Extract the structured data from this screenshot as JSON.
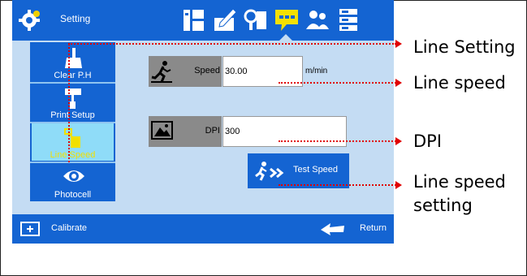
{
  "header": {
    "title": "Setting"
  },
  "sidebar": {
    "items": [
      {
        "label": "Clear P.H"
      },
      {
        "label": "Print Setup"
      },
      {
        "label": "Line Speed"
      },
      {
        "label": "Photocell"
      }
    ]
  },
  "speed": {
    "label": "Speed",
    "value": "30.00",
    "unit": "m/min"
  },
  "dpi": {
    "label": "DPI",
    "value": "300"
  },
  "test_button": {
    "label": "Test Speed"
  },
  "footer": {
    "calibrate_label": "Calibrate",
    "return_label": "Return"
  },
  "callouts": {
    "line_setting": "Line Setting",
    "line_speed": "Line speed",
    "dpi": "DPI",
    "line_speed_setting_1": "Line speed",
    "line_speed_setting_2": "setting"
  },
  "colors": {
    "bar_blue": "#1464d2",
    "screen_bg": "#c4dcf3",
    "active_item": "#8fdcf8",
    "accent_yellow": "#f0e000",
    "leader_red": "#e00000"
  }
}
